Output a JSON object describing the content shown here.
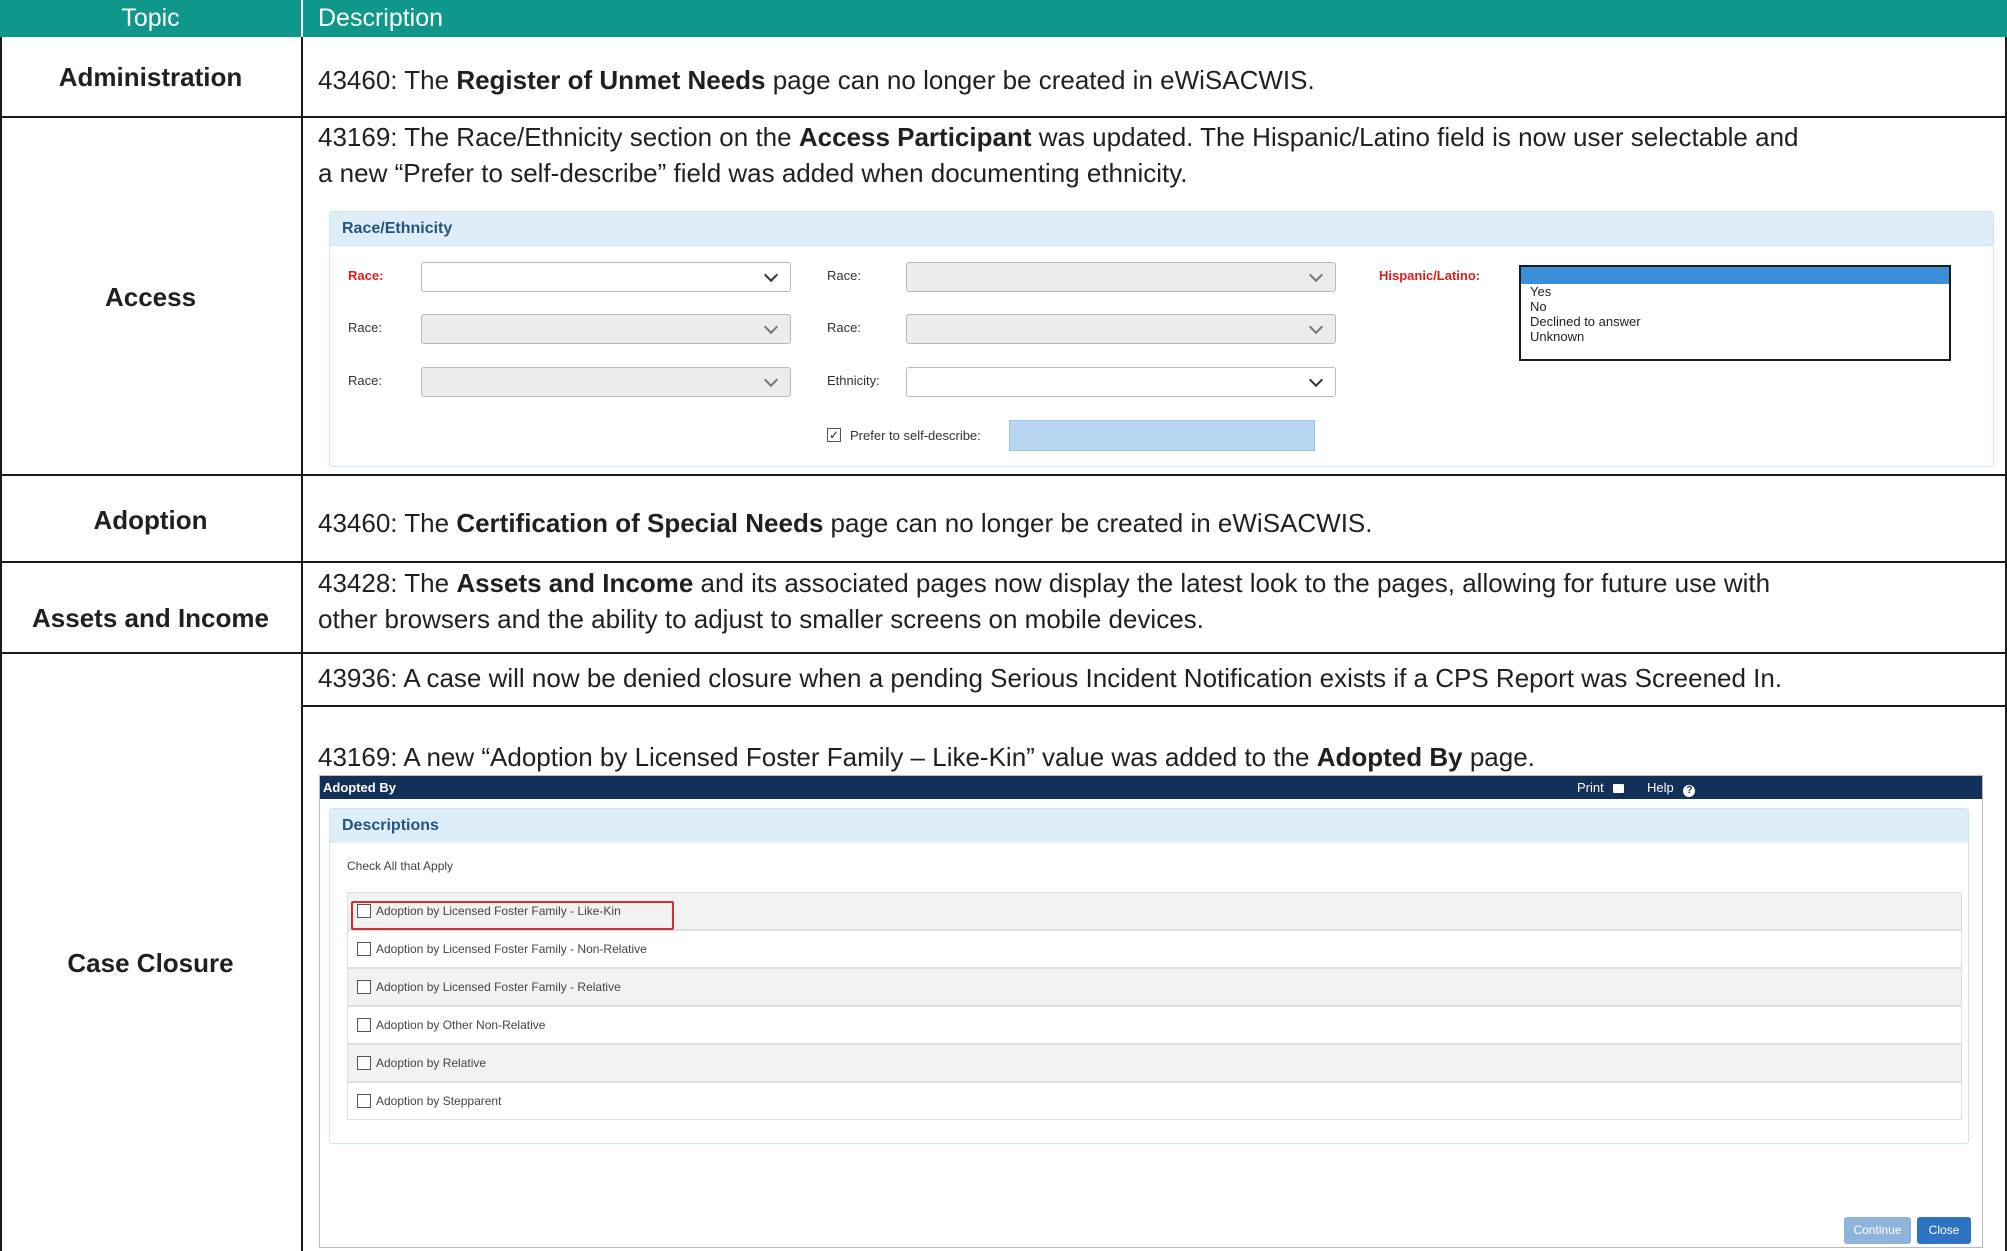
{
  "header": {
    "topic": "Topic",
    "description": "Description"
  },
  "rows": [
    {
      "topic": "Administration",
      "segments": [
        "43460: The ",
        "Register of Unmet Needs",
        " page can no longer be created in eWiSACWIS."
      ]
    },
    {
      "topic": "Access",
      "lines": [
        [
          "43169: The Race/Ethnicity section on the ",
          "Access Participant",
          " was updated. The Hispanic/Latino field is now user selectable and"
        ],
        [
          "a new “Prefer to self-describe” field was added when documenting ethnicity."
        ]
      ]
    },
    {
      "topic": "Adoption",
      "segments": [
        "43460: The ",
        "Certification of Special Needs",
        " page can no longer be created in eWiSACWIS."
      ]
    },
    {
      "topic": "Assets and Income",
      "lines": [
        [
          "43428: The ",
          "Assets and Income",
          " and its associated pages now display the latest look to the pages, allowing for future use with"
        ],
        [
          "other browsers and the ability to adjust to smaller screens on mobile devices."
        ]
      ]
    },
    {
      "topic": "Case Closure",
      "line1": "43936: A case will now be denied closure when a pending Serious Incident Notification exists if a CPS Report was Screened In.",
      "line2": [
        "43169: A new “Adoption by Licensed Foster Family – Like-Kin” value was added to the ",
        "Adopted By",
        " page."
      ]
    }
  ],
  "race_panel": {
    "title": "Race/Ethnicity",
    "race_label": "Race:",
    "ethnicity_label": "Ethnicity:",
    "hispanic_label": "Hispanic/Latino:",
    "hispanic_options": [
      "Yes",
      "No",
      "Declined to answer",
      "Unknown"
    ],
    "self_describe_label": "Prefer to self-describe:",
    "self_describe_checked": true
  },
  "adopted_by": {
    "window_title": "Adopted By",
    "print_label": "Print",
    "help_label": "Help",
    "panel_title": "Descriptions",
    "check_all_label": "Check All that Apply",
    "items": [
      "Adoption by Licensed Foster Family - Like-Kin",
      "Adoption by Licensed Foster Family - Non-Relative",
      "Adoption by Licensed Foster Family - Relative",
      "Adoption by Other Non-Relative",
      "Adoption by Relative",
      "Adoption by Stepparent"
    ],
    "continue_label": "Continue",
    "close_label": "Close"
  },
  "colors": {
    "header_bg": "#0e978a",
    "title_bar": "#12305a",
    "panel_head": "#ddeef8",
    "required_label": "#d62020",
    "highlight_box": "#d03030"
  }
}
